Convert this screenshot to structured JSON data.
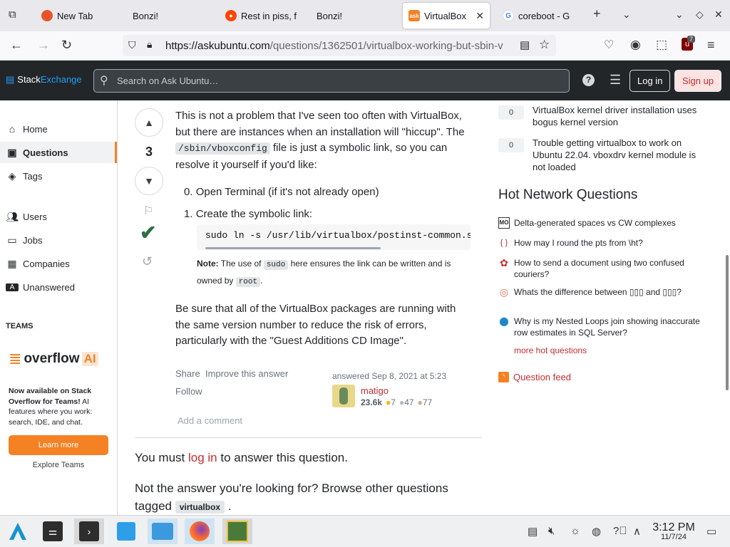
{
  "browser": {
    "tabs": [
      {
        "label": "New Tab",
        "active": false
      },
      {
        "label": "Bonzi!",
        "active": false
      },
      {
        "label": "Rest in piss, f",
        "active": false
      },
      {
        "label": "Bonzi!",
        "active": false
      },
      {
        "label": "VirtualBox",
        "active": true
      },
      {
        "label": "coreboot - G",
        "active": false
      }
    ],
    "url_host": "https://askubuntu.com",
    "url_path": "/questions/1362501/virtualbox-working-but-sbin-v",
    "extension_badge": "7"
  },
  "topbar": {
    "logo_a": "Stack",
    "logo_b": "Exchange",
    "search_placeholder": "Search on Ask Ubuntu…",
    "login": "Log in",
    "signup": "Sign up"
  },
  "leftnav": {
    "items": [
      "Home",
      "Questions",
      "Tags",
      "Users",
      "Jobs",
      "Companies",
      "Unanswered"
    ],
    "teams_header": "TEAMS",
    "overflow": "overflow",
    "ai": "AI",
    "promo_bold": "Now available on Stack Overflow for Teams!",
    "promo_rest": " AI features where you work: search, IDE, and chat.",
    "learn_more": "Learn more",
    "explore": "Explore Teams"
  },
  "answer": {
    "score": "3",
    "p1_a": "This is not a problem that I've seen too often with VirtualBox, but there are instances when an installation will \"hiccup\". The ",
    "p1_code": "/sbin/vboxconfig",
    "p1_b": " file is just a symbolic link, so you can resolve it yourself if you'd like:",
    "step0_num": "0.",
    "step0": "Open Terminal (if it's not already open)",
    "step1_num": "1.",
    "step1": "Create the symbolic link:",
    "command": "sudo ln -s /usr/lib/virtualbox/postinst-common.s",
    "note_label": "Note:",
    "note_a": " The use of ",
    "note_code1": "sudo",
    "note_b": " here ensures the link can be written and is owned by ",
    "note_code2": "root",
    "note_c": ".",
    "p2": "Be sure that all of the VirtualBox packages are running with the same version number to reduce the risk of errors, particularly with the \"Guest Additions CD Image\".",
    "share": "Share",
    "improve": "Improve this answer",
    "follow": "Follow",
    "answered": "answered Sep 8, 2021 at 5:23",
    "user": "matigo",
    "rep": "23.6k",
    "gold": "7",
    "silver": "47",
    "bronze": "77",
    "add_comment": "Add a comment"
  },
  "footer_text": {
    "must_a": "You must ",
    "must_link": "log in",
    "must_b": " to answer this question.",
    "notanswer_a": "Not the answer you're looking for? Browse other questions tagged ",
    "tag": "virtualbox",
    "notanswer_b": "."
  },
  "related": [
    {
      "count": "0",
      "title": "VirtualBox kernel driver installation uses bogus kernel version"
    },
    {
      "count": "0",
      "title": "Trouble getting virtualbox to work on Ubuntu 22.04. vboxdrv kernel module is not loaded"
    }
  ],
  "hot_network": {
    "title": "Hot Network Questions",
    "items": [
      {
        "site": "MO",
        "title": "Delta-generated spaces vs CW complexes",
        "color": "#333"
      },
      {
        "site": "{ }",
        "title": "How may I round the pts from \\ht?",
        "color": "#c22e32"
      },
      {
        "site": "✿",
        "title": "How to send a document using two confused couriers?",
        "color": "#c22e32"
      },
      {
        "site": "◎",
        "title": "Whats the difference between ▯▯▯ and ▯▯▯?",
        "color": "#e07050"
      },
      {
        "site": "⬤",
        "title": "Why is my Nested Loops join showing inaccurate row estimates in SQL Server?",
        "color": "#1e88c8"
      }
    ],
    "more": "more hot questions"
  },
  "question_feed": "Question feed",
  "clock": {
    "time": "3:12 PM",
    "date": "11/7/24"
  }
}
